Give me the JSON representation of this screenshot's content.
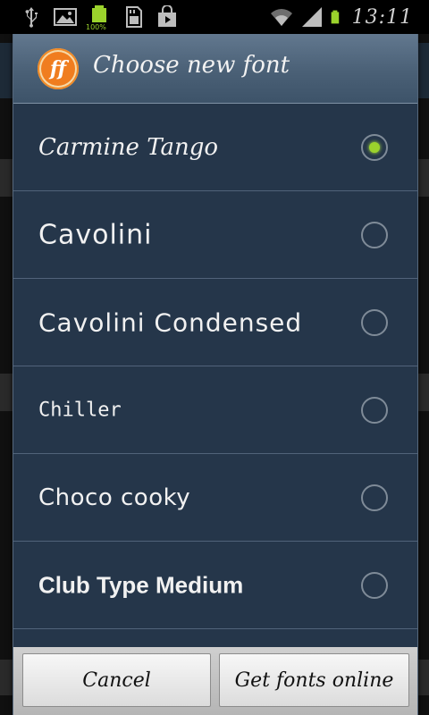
{
  "status_bar": {
    "battery_percent_label": "100%",
    "time": "13:11",
    "accent_color": "#9bd22c",
    "icons_left": [
      "usb-icon",
      "image-icon",
      "battery-full-icon",
      "sd-card-icon",
      "play-store-icon"
    ],
    "icons_right": [
      "wifi-icon",
      "signal-icon",
      "battery-icon"
    ]
  },
  "dialog": {
    "title": "Choose new font",
    "logo_text": "ff",
    "fonts": [
      {
        "name": "Carmine Tango",
        "selected": true
      },
      {
        "name": "Cavolini",
        "selected": false
      },
      {
        "name": "Cavolini Condensed",
        "selected": false
      },
      {
        "name": "Chiller",
        "selected": false
      },
      {
        "name": "Choco cooky",
        "selected": false
      },
      {
        "name": "Club Type Medium",
        "selected": false
      }
    ],
    "buttons": {
      "cancel": "Cancel",
      "get_fonts_online": "Get fonts online"
    }
  }
}
